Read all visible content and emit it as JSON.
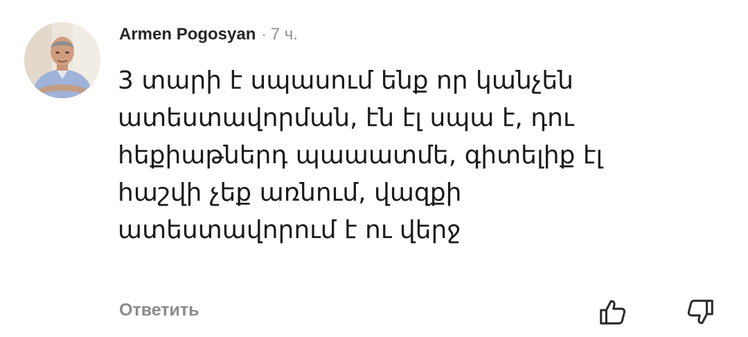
{
  "comment": {
    "author": "Armen Pogosyan",
    "separator": "·",
    "time": "7 ч.",
    "text_lines": [
      "3 տարի է սպասում ենք որ կանչեն",
      "ատեստավորման, էն էլ սպա է, դու",
      "հեքիաթներդ պաաատմե, գիտելիք էլ",
      "հաշվի չեք առնում, վազքի",
      "ատեստավորում է ու վերջ"
    ]
  },
  "actions": {
    "reply_label": "Ответить",
    "like_icon": "thumbs-up-outline",
    "dislike_icon": "thumbs-down-outline"
  },
  "colors": {
    "text": "#1a1a1a",
    "secondary": "#8e8e93",
    "icon": "#2b2b2b"
  }
}
